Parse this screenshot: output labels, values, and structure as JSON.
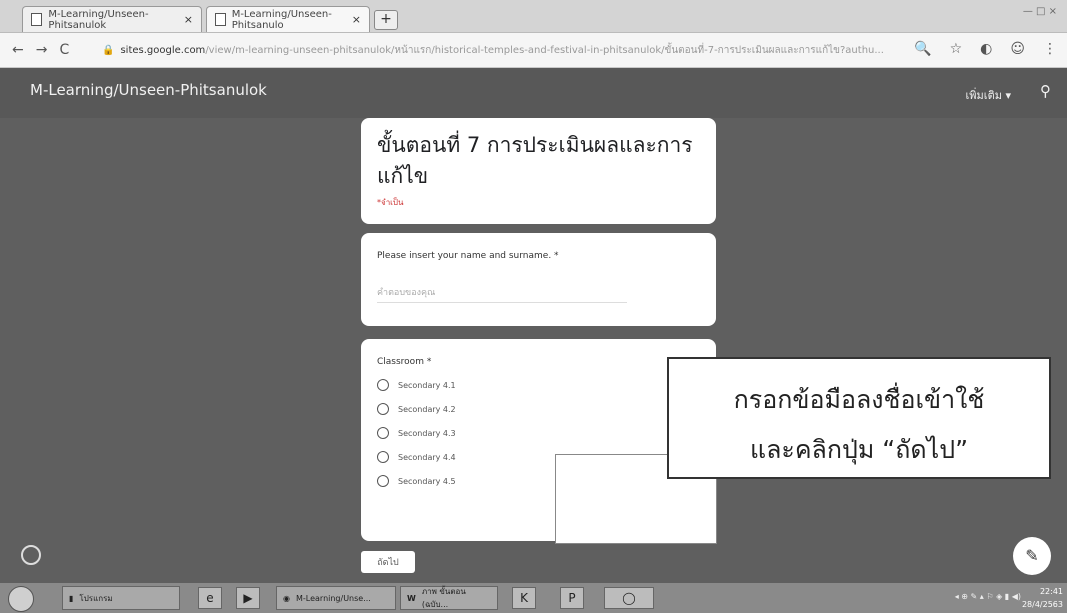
{
  "browser": {
    "tabs": [
      {
        "label": "M-Learning/Unseen-Phitsanulok"
      },
      {
        "label": "M-Learning/Unseen-Phitsanulo"
      }
    ],
    "new_tab_label": "+",
    "url_host": "sites.google.com",
    "url_path": "/view/m-learning-unseen-phitsanulok/หน้าแรก/historical-temples-and-festival-in-phitsanulok/ขั้นตอนที่-7-การประเมินผลและการแก้ไข?authu..."
  },
  "site": {
    "title": "M-Learning/Unseen-Phitsanulok",
    "more_label": "เพิ่มเติม"
  },
  "form": {
    "title": "ขั้นตอนที่ 7 การประเมินผลและการแก้ไข",
    "required_note": "*จำเป็น",
    "name_question": "Please insert your name and surname. *",
    "name_placeholder": "คำตอบของคุณ",
    "classroom_question": "Classroom *",
    "options": [
      "Secondary 4.1",
      "Secondary 4.2",
      "Secondary 4.3",
      "Secondary 4.4",
      "Secondary 4.5"
    ],
    "next_label": "ถัดไป"
  },
  "callout": {
    "line1": "กรอกข้อมือลงชื่อเข้าใช้",
    "line2": "และคลิกปุ่ม “ถัดไป”"
  },
  "taskbar": {
    "items": [
      "โปรแกรม",
      "M-Learning/Unse...",
      "ภาพ ขั้นตอน (ฉบับ..."
    ],
    "time": "22:41",
    "date": "28/4/2563"
  }
}
